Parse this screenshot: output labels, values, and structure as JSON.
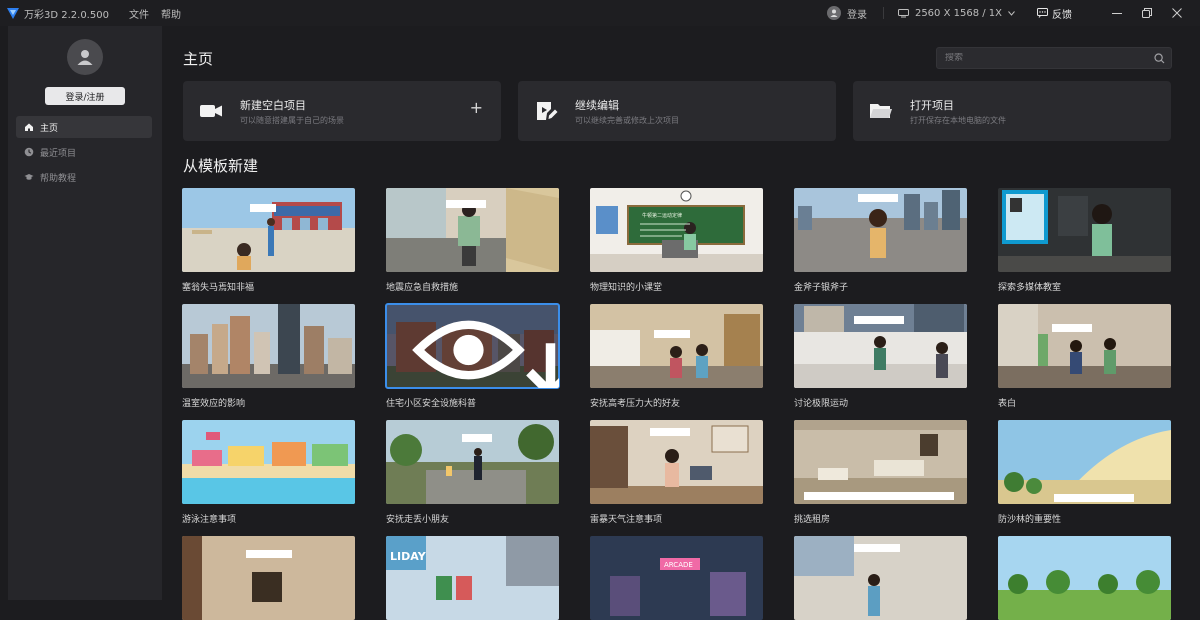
{
  "app": {
    "title": "万彩3D 2.2.0.500",
    "menu": [
      "文件",
      "帮助"
    ],
    "login_label": "登录",
    "resolution": "2560 X 1568 / 1X",
    "feedback": "反馈"
  },
  "sidebar": {
    "login_button": "登录/注册",
    "items": [
      {
        "label": "主页",
        "icon": "home-icon",
        "active": true
      },
      {
        "label": "最近项目",
        "icon": "clock-icon",
        "active": false
      },
      {
        "label": "帮助教程",
        "icon": "graduation-cap-icon",
        "active": false
      }
    ]
  },
  "main": {
    "title": "主页",
    "search_placeholder": "搜索",
    "actions": [
      {
        "title": "新建空白项目",
        "subtitle": "可以随意搭建属于自己的场景",
        "icon": "video-camera-icon"
      },
      {
        "title": "继续编辑",
        "subtitle": "可以继续完善或修改上次项目",
        "icon": "edit-play-icon"
      },
      {
        "title": "打开项目",
        "subtitle": "打开保存在本地电脑的文件",
        "icon": "folder-icon"
      }
    ],
    "section_title": "从模板新建",
    "templates": [
      [
        "塞翁失马焉知非福",
        "地震应急自救措施",
        "物理知识的小课堂",
        "金斧子银斧子",
        "探索多媒体教室"
      ],
      [
        "温室效应的影响",
        "住宅小区安全设施科普",
        "安抚高考压力大的好友",
        "讨论极限运动",
        "表白"
      ],
      [
        "游泳注意事项",
        "安抚走丢小朋友",
        "雷暴天气注意事项",
        "挑选租房",
        "防沙林的重要性"
      ],
      [
        "",
        "",
        "",
        "",
        ""
      ]
    ],
    "thumb_texts": {
      "classroom_board": "牛顿第二运动定律",
      "arcade": "ARCADE",
      "holiday": "LIDAY"
    }
  },
  "colors": {
    "accent": "#3b8eea",
    "background": "#1c1c1f",
    "sidebar": "#26262a",
    "card": "#2a2a2e"
  }
}
